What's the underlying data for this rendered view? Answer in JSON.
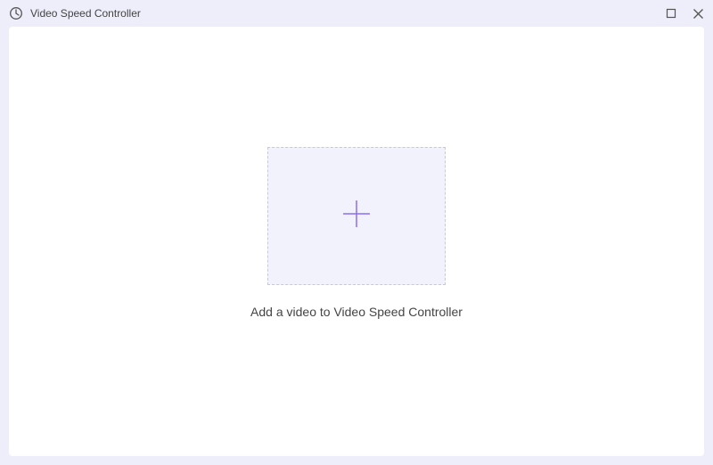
{
  "titlebar": {
    "title": "Video Speed Controller"
  },
  "main": {
    "prompt": "Add a video to Video Speed Controller"
  }
}
